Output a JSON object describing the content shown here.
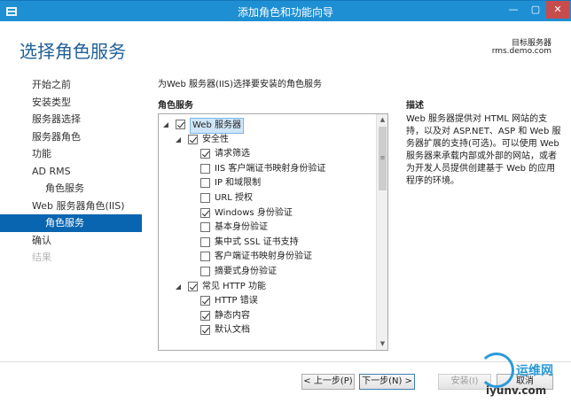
{
  "window": {
    "title": "添加角色和功能向导",
    "min_glyph": "—",
    "max_glyph": "▢",
    "close_glyph": "✕"
  },
  "header": {
    "title": "选择角色服务",
    "dest_label": "目标服务器",
    "dest_server": "rms.demo.com"
  },
  "nav": {
    "items": [
      {
        "label": "开始之前",
        "state": "normal"
      },
      {
        "label": "安装类型",
        "state": "normal"
      },
      {
        "label": "服务器选择",
        "state": "normal"
      },
      {
        "label": "服务器角色",
        "state": "normal"
      },
      {
        "label": "功能",
        "state": "normal"
      },
      {
        "label": "AD RMS",
        "state": "normal"
      },
      {
        "label": "角色服务",
        "state": "sub"
      },
      {
        "label": "Web 服务器角色(IIS)",
        "state": "normal"
      },
      {
        "label": "角色服务",
        "state": "active"
      },
      {
        "label": "确认",
        "state": "normal"
      },
      {
        "label": "结果",
        "state": "disabled"
      }
    ]
  },
  "main": {
    "description": "为Web 服务器(IIS)选择要安装的角色服务",
    "roles_header": "角色服务",
    "desc_header": "描述",
    "desc_text": "Web 服务器提供对 HTML 网站的支持，以及对 ASP.NET、ASP 和 Web 服务器扩展的支持(可选)。可以使用 Web 服务器来承载内部或外部的网站，或者为开发人员提供创建基于 Web 的应用程序的环境。"
  },
  "tree": {
    "items": [
      {
        "label": "Web 服务器",
        "level": 0,
        "expander": "open",
        "checked": true,
        "selected": true
      },
      {
        "label": "安全性",
        "level": 1,
        "expander": "open",
        "checked": true,
        "selected": false
      },
      {
        "label": "请求筛选",
        "level": 2,
        "expander": "none",
        "checked": true,
        "selected": false
      },
      {
        "label": "IIS 客户端证书映射身份验证",
        "level": 2,
        "expander": "none",
        "checked": false,
        "selected": false
      },
      {
        "label": "IP 和域限制",
        "level": 2,
        "expander": "none",
        "checked": false,
        "selected": false
      },
      {
        "label": "URL 授权",
        "level": 2,
        "expander": "none",
        "checked": false,
        "selected": false
      },
      {
        "label": "Windows 身份验证",
        "level": 2,
        "expander": "none",
        "checked": true,
        "selected": false
      },
      {
        "label": "基本身份验证",
        "level": 2,
        "expander": "none",
        "checked": false,
        "selected": false
      },
      {
        "label": "集中式 SSL 证书支持",
        "level": 2,
        "expander": "none",
        "checked": false,
        "selected": false
      },
      {
        "label": "客户端证书映射身份验证",
        "level": 2,
        "expander": "none",
        "checked": false,
        "selected": false
      },
      {
        "label": "摘要式身份验证",
        "level": 2,
        "expander": "none",
        "checked": false,
        "selected": false
      },
      {
        "label": "常见 HTTP 功能",
        "level": 1,
        "expander": "open",
        "checked": true,
        "selected": false
      },
      {
        "label": "HTTP 错误",
        "level": 2,
        "expander": "none",
        "checked": true,
        "selected": false
      },
      {
        "label": "静态内容",
        "level": 2,
        "expander": "none",
        "checked": true,
        "selected": false
      },
      {
        "label": "默认文档",
        "level": 2,
        "expander": "none",
        "checked": true,
        "selected": false
      }
    ],
    "scroll_up": "▲",
    "scroll_down": "▼",
    "scroll_grip": "≡"
  },
  "buttons": {
    "prev": "< 上一步(P)",
    "next": "下一步(N) >",
    "install": "安装(I)",
    "cancel": "取消"
  },
  "watermark": {
    "title": "运维网",
    "url": "iyunv.com"
  },
  "colors": {
    "titlebar": "#1f8fd4",
    "accent_title": "#1f5f98",
    "nav_active": "#0a65b0",
    "close_button": "#c74c4c"
  }
}
